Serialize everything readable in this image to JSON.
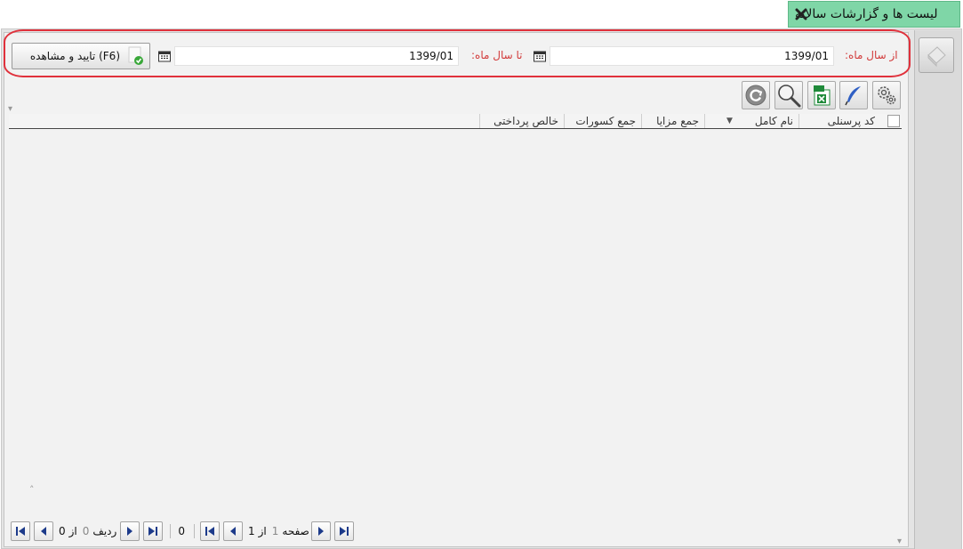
{
  "tab": {
    "title": "لیست ها و گزارشات سالانه",
    "close_icon": "close-icon"
  },
  "filter": {
    "from_label": "از سال ماه:",
    "from_value": "1399/01",
    "to_label": "تا سال ماه:",
    "to_value": "1399/01",
    "confirm_label": "تایید و مشاهده (F6)",
    "accent": "#e0313c"
  },
  "grid": {
    "columns": [
      "کد پرسنلی",
      "نام کامل",
      "جمع مزایا",
      "جمع کسورات",
      "خالص پرداختی"
    ]
  },
  "pager": {
    "page_label": "صفحه",
    "page_current": "1",
    "of_label": "از",
    "page_total": "1",
    "count": "0",
    "row_label": "ردیف",
    "row_current": "0",
    "row_of_label": "از",
    "row_total": "0"
  },
  "colors": {
    "tab_bg": "#7fd6a7",
    "label_red": "#d23a3a"
  }
}
